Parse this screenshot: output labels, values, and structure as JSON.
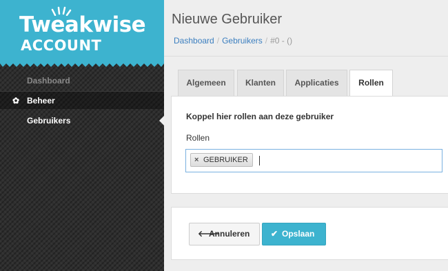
{
  "brand": {
    "logo_main": "Tweakwise",
    "logo_sub": "ACCOUNT",
    "color": "#3db3cf"
  },
  "sidebar": {
    "items": [
      {
        "label": "Dashboard",
        "icon": ""
      },
      {
        "label": "Beheer",
        "icon": "gear-icon"
      },
      {
        "label": "Gebruikers",
        "icon": "",
        "active": true
      }
    ]
  },
  "header": {
    "title": "Nieuwe Gebruiker",
    "breadcrumb": [
      "Dashboard",
      "Gebruikers",
      "#0 - ()"
    ]
  },
  "tabs": [
    {
      "label": "Algemeen"
    },
    {
      "label": "Klanten"
    },
    {
      "label": "Applicaties"
    },
    {
      "label": "Rollen",
      "active": true
    }
  ],
  "roles_panel": {
    "heading": "Koppel hier rollen aan deze gebruiker",
    "field_label": "Rollen",
    "tags": [
      "GEBRUIKER"
    ],
    "tag_remove_glyph": "×"
  },
  "actions": {
    "cancel_label": "Annuleren",
    "save_label": "Opslaan",
    "cancel_icon": "arrow-left-icon",
    "save_icon": "check-icon"
  }
}
